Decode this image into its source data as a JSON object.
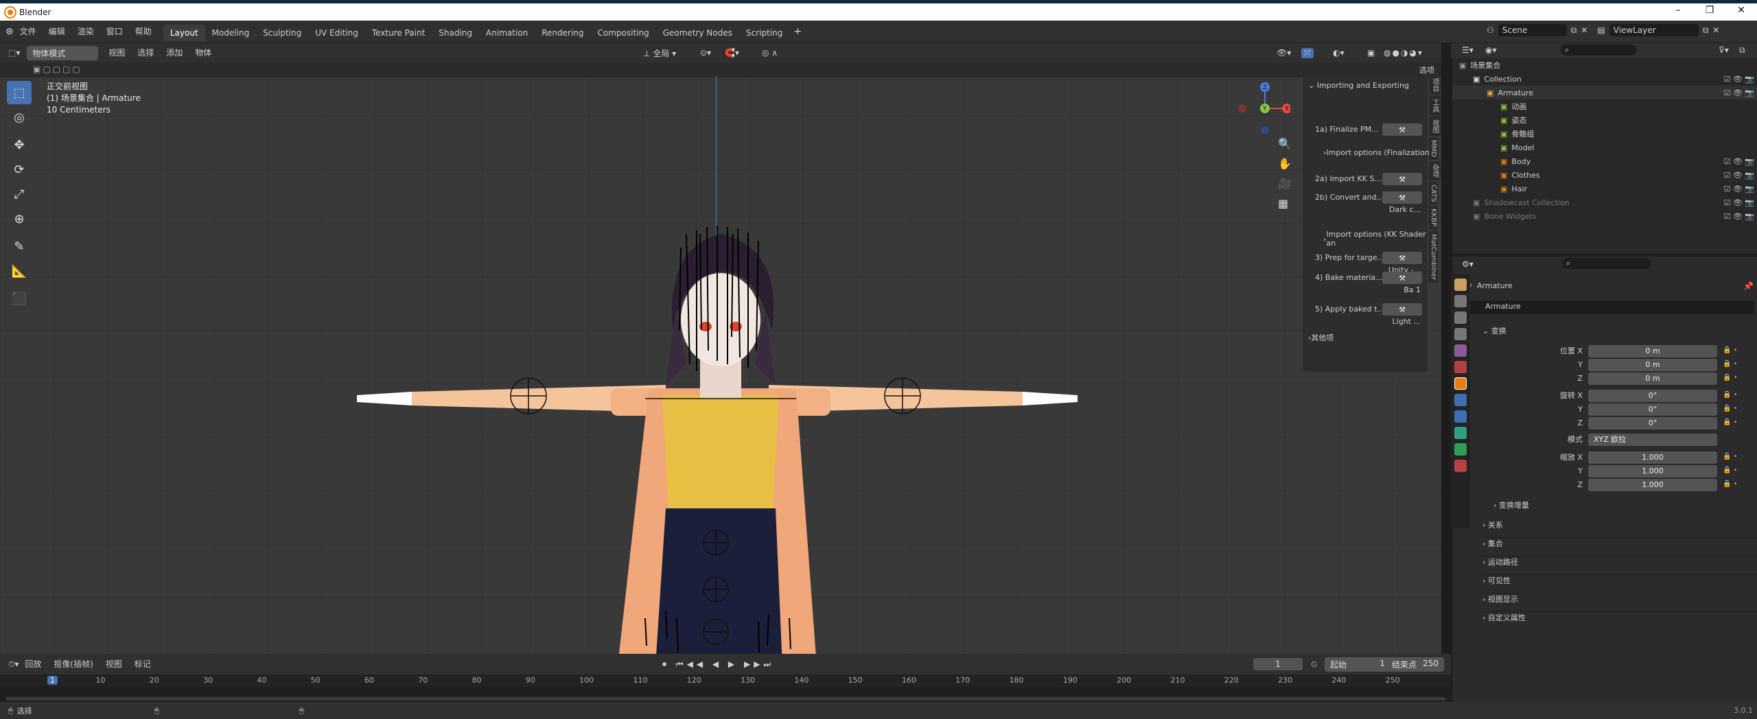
{
  "window": {
    "title": "Blender"
  },
  "menu": [
    "文件",
    "编辑",
    "渲染",
    "窗口",
    "帮助"
  ],
  "workspaces": [
    "Layout",
    "Modeling",
    "Sculpting",
    "UV Editing",
    "Texture Paint",
    "Shading",
    "Animation",
    "Rendering",
    "Compositing",
    "Geometry Nodes",
    "Scripting"
  ],
  "active_workspace": "Layout",
  "topright": {
    "scene": "Scene",
    "view_layer": "ViewLayer"
  },
  "viewport_header": {
    "mode": "物体模式",
    "menus": [
      "视图",
      "选择",
      "添加",
      "物体"
    ],
    "transform": "全局",
    "options": "选项"
  },
  "viewport_info": {
    "line1": "正交前视图",
    "line2": "(1) 场景集合 | Armature",
    "line3": "10 Centimeters"
  },
  "npanel": {
    "header": "Importing and Exporting",
    "rows": [
      {
        "label": "1a) Finalize PM..."
      },
      {
        "label": "Import options (Finalization)"
      },
      {
        "label": "2a) Import KK S..."
      },
      {
        "label": "2b) Convert and...",
        "sub": "Dark c..."
      },
      {
        "label": "Import options (KK Shader an"
      },
      {
        "label": "3) Prep for targe...",
        "sub": "Unity -..."
      },
      {
        "label": "4) Bake materia...",
        "sub": "Ba   1"
      },
      {
        "label": "5) Apply baked t...",
        "sub": "Light ..."
      },
      {
        "label": "其他项"
      }
    ]
  },
  "side_tabs": [
    "项目",
    "工具",
    "视图",
    "MMD",
    "杂项",
    "CATS",
    "KKBP",
    "MatCombiner"
  ],
  "outliner": {
    "rows": [
      {
        "label": "场景集合"
      },
      {
        "label": "Collection"
      },
      {
        "label": "Armature"
      },
      {
        "label": "动画"
      },
      {
        "label": "姿态"
      },
      {
        "label": "骨骼组"
      },
      {
        "label": "Model"
      },
      {
        "label": "Body"
      },
      {
        "label": "Clothes"
      },
      {
        "label": "Hair"
      },
      {
        "label": "Shadowcast Collection"
      },
      {
        "label": "Bone Widgets"
      }
    ]
  },
  "properties": {
    "object_name": "Armature",
    "data_name": "Armature",
    "section_transform": "变换",
    "location_label": "位置 X",
    "rotation_label": "旋转 X",
    "scale_label": "缩放 X",
    "axis_y": "Y",
    "axis_z": "Z",
    "loc": [
      "0 m",
      "0 m",
      "0 m"
    ],
    "rot": [
      "0°",
      "0°",
      "0°"
    ],
    "mode_label": "模式",
    "mode": "XYZ 欧拉",
    "scale": [
      "1.000",
      "1.000",
      "1.000"
    ],
    "delta": "变换增量",
    "sections": [
      "关系",
      "集合",
      "运动路径",
      "可见性",
      "视图显示",
      "自定义属性"
    ]
  },
  "timeline": {
    "menus": [
      "回放",
      "抠像(插帧)",
      "视图",
      "标记"
    ],
    "current_frame": "1",
    "start_label": "起始",
    "start": "1",
    "end_label": "结束点",
    "end": "250",
    "ticks": [
      "1",
      "10",
      "20",
      "30",
      "40",
      "50",
      "60",
      "70",
      "80",
      "90",
      "100",
      "110",
      "120",
      "130",
      "140",
      "150",
      "160",
      "170",
      "180",
      "190",
      "200",
      "210",
      "220",
      "230",
      "240",
      "250"
    ]
  },
  "status": {
    "left": "选择",
    "version": "3.0.1"
  },
  "colors": {
    "accent": "#4772b3",
    "orange": "#e87d0d"
  }
}
